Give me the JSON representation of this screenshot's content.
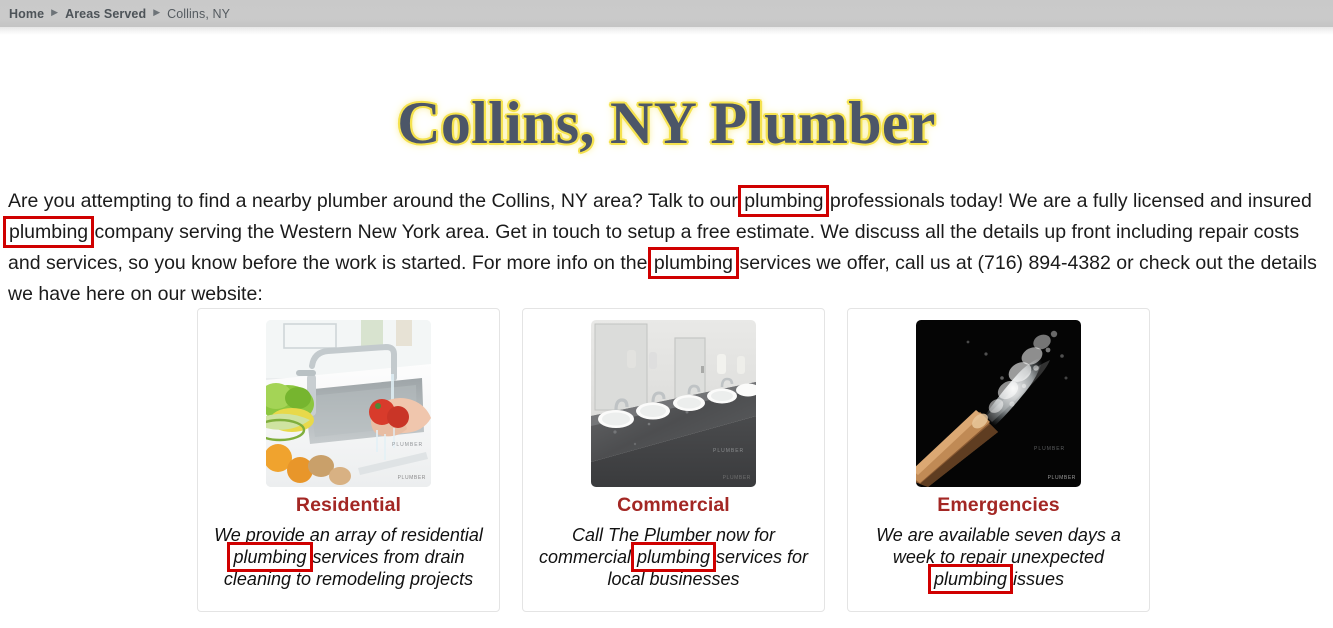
{
  "breadcrumb": {
    "items": [
      {
        "label": "Home",
        "strong": true
      },
      {
        "label": "Areas Served",
        "strong": true
      },
      {
        "label": "Collins, NY",
        "strong": false
      }
    ],
    "separator": "▶"
  },
  "header": {
    "title": "Collins, NY Plumber",
    "title_color": "#4c5668",
    "title_glow_color": "#f5e24e"
  },
  "intro": {
    "part1": "Are you attempting to find a nearby plumber around the Collins, NY area? Talk to our ",
    "hl1": "plumbing",
    "part2": " professionals today! We are a fully licensed and insured ",
    "hl2": "plumbing",
    "part3": " company serving the Western New York area. Get in touch to setup a free estimate. We discuss all the details up front including repair costs and services, so you know before the work is started. For more info on the ",
    "hl3": "plumbing",
    "part4": " services we offer, call us at (716) 894-4382 or check out the details we have here on our website:",
    "phone": "(716) 894-4382"
  },
  "highlight": {
    "color": "#d00000",
    "border_width_px": 3,
    "term": "plumbing",
    "count": 6
  },
  "cards": [
    {
      "title": "Residential",
      "image_alt": "kitchen-sink-washing-vegetables",
      "watermark": "PLUMBER",
      "text_part1": "We provide an array of residential ",
      "hl": "plumbing",
      "text_part2": " services from drain cleaning to remodeling projects"
    },
    {
      "title": "Commercial",
      "image_alt": "commercial-restroom-sink-row",
      "watermark": "PLUMBER",
      "text_part1": "Call The Plumber now for commercial ",
      "hl": "plumbing",
      "text_part2": " services for local businesses"
    },
    {
      "title": "Emergencies",
      "image_alt": "burst-pipe-water-spray",
      "watermark": "PLUMBER",
      "text_part1": "We are available seven days a week to repair unexpected ",
      "hl": "plumbing",
      "text_part2": " issues"
    }
  ],
  "colors": {
    "breadcrumb_bar": "#c9c9c9",
    "card_border": "#e4e4e4",
    "card_title": "#a32724",
    "body_text": "#1b1b1b",
    "page_background": "#ffffff"
  }
}
